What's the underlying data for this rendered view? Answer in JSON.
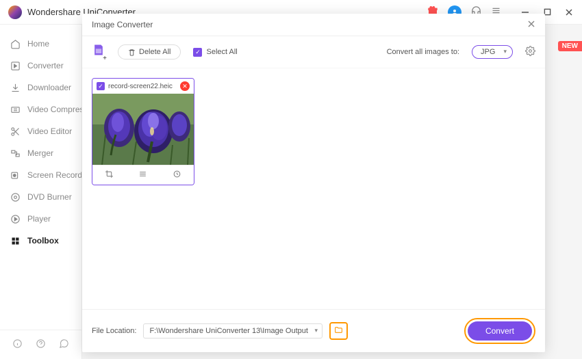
{
  "app": {
    "title": "Wondershare UniConverter"
  },
  "sidebar": {
    "items": [
      {
        "label": "Home"
      },
      {
        "label": "Converter"
      },
      {
        "label": "Downloader"
      },
      {
        "label": "Video Compressor"
      },
      {
        "label": "Video Editor"
      },
      {
        "label": "Merger"
      },
      {
        "label": "Screen Recorder"
      },
      {
        "label": "DVD Burner"
      },
      {
        "label": "Player"
      },
      {
        "label": "Toolbox"
      }
    ],
    "active_index": 9
  },
  "badge": {
    "new": "NEW"
  },
  "modal": {
    "title": "Image Converter",
    "toolbar": {
      "delete_all": "Delete All",
      "select_all": "Select All",
      "convert_label": "Convert all images to:",
      "format": "JPG"
    },
    "file": {
      "name": "record-screen22.heic",
      "checked": true
    },
    "footer": {
      "file_location_label": "File Location:",
      "output_path": "F:\\Wondershare UniConverter 13\\Image Output",
      "convert_label": "Convert"
    }
  }
}
